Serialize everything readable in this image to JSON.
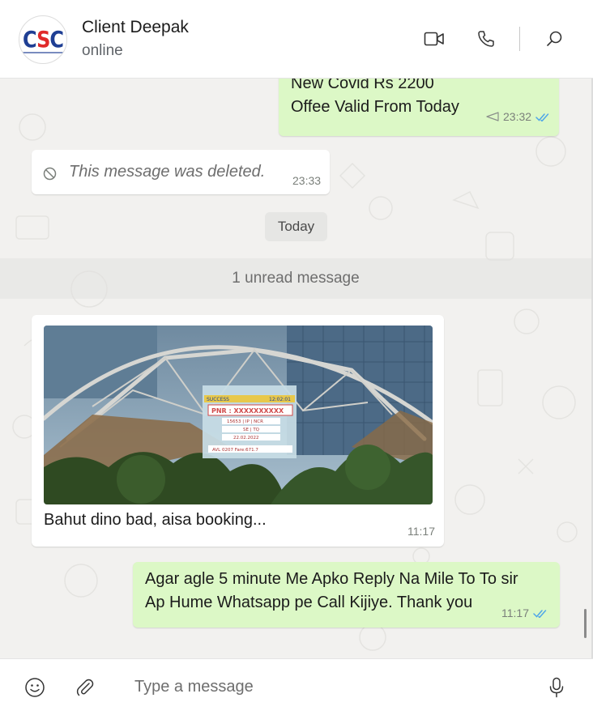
{
  "header": {
    "logo_text_left": "C",
    "logo_text_mid": "S",
    "logo_text_right": "C",
    "name": "Client Deepak",
    "status": "online"
  },
  "messages": {
    "covid": {
      "line1": "New Covid Rs 2200",
      "line2": "Offee Valid From Today",
      "time": "23:32"
    },
    "deleted": {
      "text": "This message was deleted.",
      "time": "23:33"
    },
    "day_label": "Today",
    "unread_label": "1 unread message",
    "photo": {
      "screen_rows": [
        "SUCCESS",
        "12:02:01",
        "PNR : XXXXXXXXXX",
        "15653 | IP | NCR",
        "SE | TQ",
        "22.02.2022",
        "AVL 0207 Fare:671.7"
      ],
      "caption": "Bahut dino bad, aisa booking...",
      "time": "11:17"
    },
    "agar": {
      "line1": "Agar agle 5 minute Me Apko Reply Na Mile To To sir",
      "line2": "Ap Hume Whatsapp pe Call Kijiye. Thank you",
      "time": "11:17"
    }
  },
  "composer": {
    "placeholder": "Type a message"
  },
  "colors": {
    "outgoing_bubble": "#dcf8c6",
    "incoming_bubble": "#ffffff",
    "chat_bg": "#f2f1ef",
    "read_ticks": "#4fa6e8"
  },
  "icons": [
    "emoji-icon",
    "attach-icon",
    "mic-icon",
    "video-icon",
    "phone-icon",
    "search-icon",
    "ban-icon",
    "forwarded-icon",
    "double-check-icon"
  ]
}
